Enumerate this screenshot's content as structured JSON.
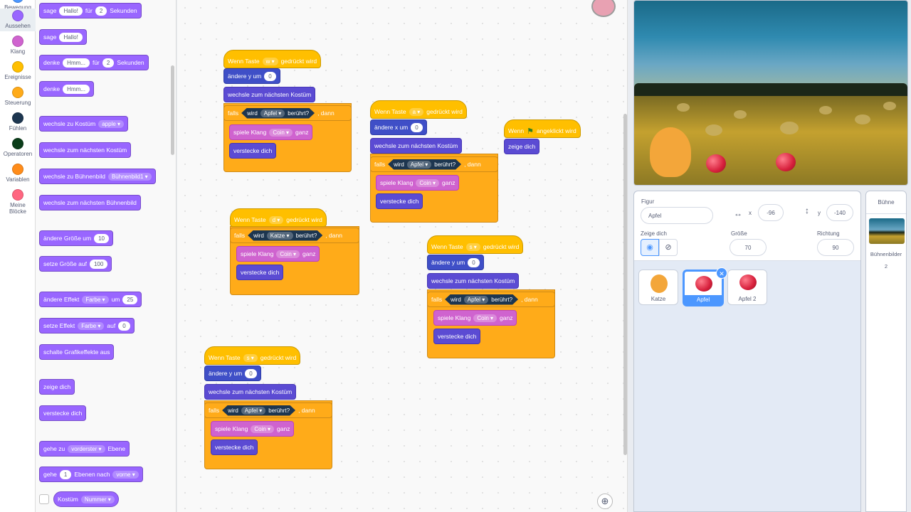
{
  "categories": [
    {
      "label": "Bewegung",
      "color": "#4c97ff"
    },
    {
      "label": "Aussehen",
      "color": "#9966ff"
    },
    {
      "label": "Klang",
      "color": "#cf63cf"
    },
    {
      "label": "Ereignisse",
      "color": "#ffbf00"
    },
    {
      "label": "Steuerung",
      "color": "#ffab19"
    },
    {
      "label": "Fühlen",
      "color": "#1d3650"
    },
    {
      "label": "Operatoren",
      "color": "#0b3d1a"
    },
    {
      "label": "Variablen",
      "color": "#ff8c1a"
    },
    {
      "label": "Meine Blöcke",
      "color": "#ff6680"
    }
  ],
  "palette": {
    "say_timed": {
      "a": "sage",
      "b": "Hallo!",
      "c": "für",
      "d": "2",
      "e": "Sekunden"
    },
    "say": {
      "a": "sage",
      "b": "Hallo!"
    },
    "think_timed": {
      "a": "denke",
      "b": "Hmm...",
      "c": "für",
      "d": "2",
      "e": "Sekunden"
    },
    "think": {
      "a": "denke",
      "b": "Hmm..."
    },
    "switch_costume": {
      "a": "wechsle zu Kostüm",
      "b": "apple"
    },
    "next_costume": "wechsle zum nächsten Kostüm",
    "switch_backdrop": {
      "a": "wechsle zu Bühnenbild",
      "b": "Bühnenbild1"
    },
    "next_backdrop": "wechsle zum nächsten Bühnenbild",
    "change_size": {
      "a": "ändere Größe um",
      "b": "10"
    },
    "set_size": {
      "a": "setze Größe auf",
      "b": "100"
    },
    "change_effect": {
      "a": "ändere Effekt",
      "b": "Farbe",
      "c": "um",
      "d": "25"
    },
    "set_effect": {
      "a": "setze Effekt",
      "b": "Farbe",
      "c": "auf",
      "d": "0"
    },
    "clear_effects": "schalte Grafikeffekte aus",
    "show": "zeige dich",
    "hide": "verstecke dich",
    "go_layer": {
      "a": "gehe zu",
      "b": "vorderster",
      "c": "Ebene"
    },
    "go_layers": {
      "a": "gehe",
      "b": "1",
      "c": "Ebenen nach",
      "d": "vorne"
    },
    "costume_num": {
      "a": "Kostüm",
      "b": "Nummer"
    }
  },
  "scripts": {
    "w": {
      "hat_a": "Wenn Taste",
      "key": "w",
      "hat_b": "gedrückt wird",
      "move_a": "ändere y um",
      "move_v": "0",
      "next": "wechsle zum nächsten Kostüm",
      "if_a": "falls",
      "cond_a": "wird",
      "cond_sprite": "Apfel",
      "cond_b": "berührt?",
      "if_b": ", dann",
      "snd_a": "spiele Klang",
      "snd_v": "Coin",
      "snd_b": "ganz",
      "hide": "verstecke dich"
    },
    "a": {
      "hat_a": "Wenn Taste",
      "key": "a",
      "hat_b": "gedrückt wird",
      "move_a": "ändere x um",
      "move_v": "0",
      "next": "wechsle zum nächsten Kostüm",
      "if_a": "falls",
      "cond_a": "wird",
      "cond_sprite": "Apfel",
      "cond_b": "berührt?",
      "if_b": ", dann",
      "snd_a": "spiele Klang",
      "snd_v": "Coin",
      "snd_b": "ganz",
      "hide": "verstecke dich"
    },
    "flag": {
      "hat_a": "Wenn",
      "hat_b": "angeklickt wird",
      "show": "zeige dich"
    },
    "d": {
      "hat_a": "Wenn Taste",
      "key": "d",
      "hat_b": "gedrückt wird",
      "if_a": "falls",
      "cond_a": "wird",
      "cond_sprite": "Katze",
      "cond_b": "berührt?",
      "if_b": ", dann",
      "snd_a": "spiele Klang",
      "snd_v": "Coin",
      "snd_b": "ganz",
      "hide": "verstecke dich"
    },
    "s1": {
      "hat_a": "Wenn Taste",
      "key": "s",
      "hat_b": "gedrückt wird",
      "move_a": "ändere y um",
      "move_v": "0",
      "next": "wechsle zum nächsten Kostüm",
      "if_a": "falls",
      "cond_a": "wird",
      "cond_sprite": "Apfel",
      "cond_b": "berührt?",
      "if_b": ", dann",
      "snd_a": "spiele Klang",
      "snd_v": "Coin",
      "snd_b": "ganz",
      "hide": "verstecke dich"
    },
    "s2": {
      "hat_a": "Wenn Taste",
      "key": "s",
      "hat_b": "gedrückt wird",
      "move_a": "ändere y um",
      "move_v": "0",
      "next": "wechsle zum nächsten Kostüm",
      "if_a": "falls",
      "cond_a": "wird",
      "cond_sprite": "Apfel",
      "cond_b": "berührt?",
      "if_b": ", dann",
      "snd_a": "spiele Klang",
      "snd_v": "Coin",
      "snd_b": "ganz",
      "hide": "verstecke dich"
    }
  },
  "sprite_info": {
    "figur_label": "Figur",
    "name": "Apfel",
    "x_label": "x",
    "x": "-96",
    "y_label": "y",
    "y": "-140",
    "show_label": "Zeige dich",
    "size_label": "Größe",
    "size": "70",
    "dir_label": "Richtung",
    "dir": "90"
  },
  "sprites": [
    {
      "name": "Katze"
    },
    {
      "name": "Apfel"
    },
    {
      "name": "Apfel 2"
    }
  ],
  "stage_panel": {
    "title": "Bühne",
    "backdrops_label": "Bühnenbilder",
    "backdrops_count": "2"
  }
}
